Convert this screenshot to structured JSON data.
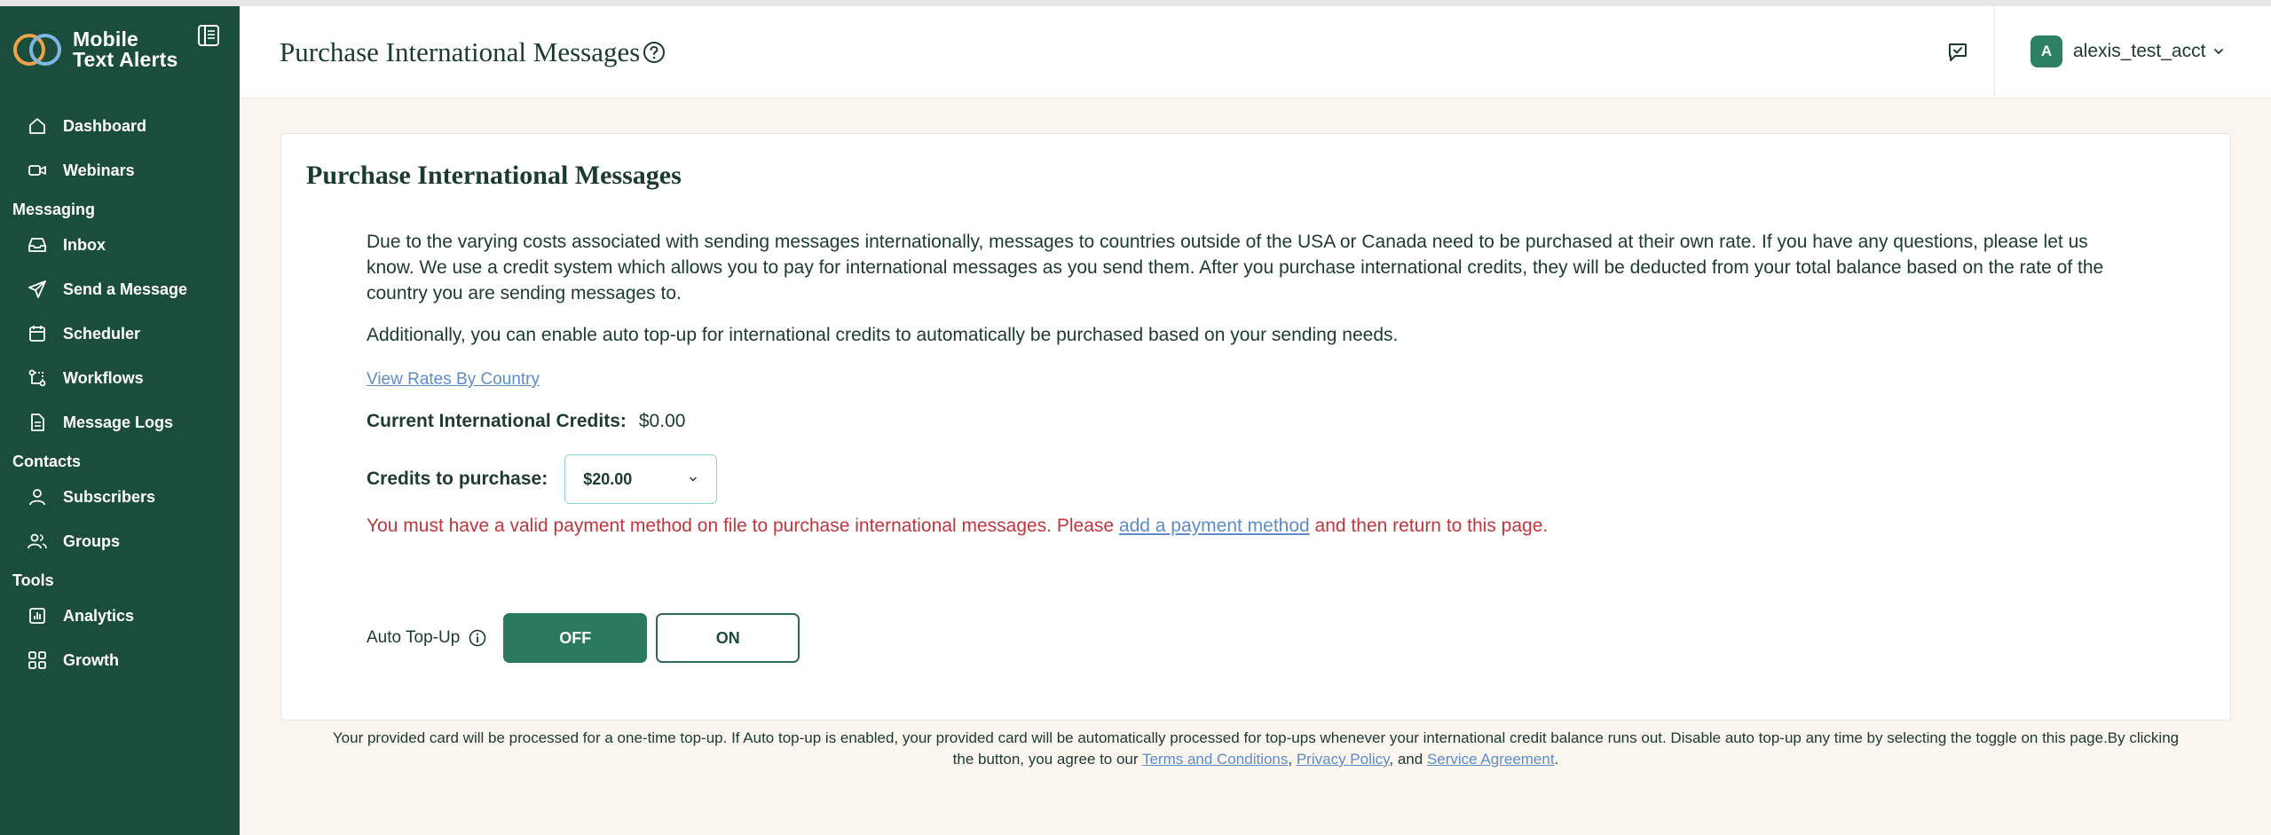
{
  "sidebar": {
    "brand_line1": "Mobile",
    "brand_line2": "Text Alerts",
    "nav": [
      {
        "label": "Dashboard"
      },
      {
        "label": "Webinars"
      },
      {
        "section": "Messaging"
      },
      {
        "label": "Inbox"
      },
      {
        "label": "Send a Message"
      },
      {
        "label": "Scheduler"
      },
      {
        "label": "Workflows"
      },
      {
        "label": "Message Logs"
      },
      {
        "section": "Contacts"
      },
      {
        "label": "Subscribers"
      },
      {
        "label": "Groups"
      },
      {
        "section": "Tools"
      },
      {
        "label": "Analytics"
      },
      {
        "label": "Growth"
      }
    ]
  },
  "header": {
    "title": "Purchase International Messages",
    "user_initial": "A",
    "user_name": "alexis_test_acct"
  },
  "card": {
    "title": "Purchase International Messages",
    "para1": "Due to the varying costs associated with sending messages internationally, messages to countries outside of the USA or Canada need to be purchased at their own rate. If you have any questions, please let us know. We use a credit system which allows you to pay for international messages as you send them. After you purchase international credits, they will be deducted from your total balance based on the rate of the country you are sending messages to.",
    "para2": "Additionally, you can enable auto top-up for international credits to automatically be purchased based on your sending needs.",
    "rates_link": "View Rates By Country",
    "current_credits_label": "Current International Credits:",
    "current_credits_value": "$0.00",
    "purchase_label": "Credits to purchase:",
    "purchase_value": "$20.00",
    "warning_before": "You must have a valid payment method on file to purchase international messages. Please ",
    "warning_link": "add a payment method",
    "warning_after": " and then return to this page.",
    "topup_label": "Auto Top-Up",
    "off_label": "OFF",
    "on_label": "ON",
    "auto_topup_state": "OFF"
  },
  "footer": {
    "text_before": "Your provided card will be processed for a one-time top-up. If Auto top-up is enabled, your provided card will be automatically processed for top-ups whenever your international credit balance runs out. Disable auto top-up any time by selecting the toggle on this page.By clicking the button, you agree to our ",
    "terms": "Terms and Conditions",
    "sep1": ", ",
    "privacy": "Privacy Policy",
    "sep2": ", and ",
    "service": "Service Agreement",
    "end": "."
  },
  "colors": {
    "sidebar_bg": "#1b4d3c",
    "accent_green": "#2c7a5e",
    "link_blue": "#5f8bc9",
    "warning_red": "#c0363c",
    "page_bg": "#faf6ee"
  }
}
